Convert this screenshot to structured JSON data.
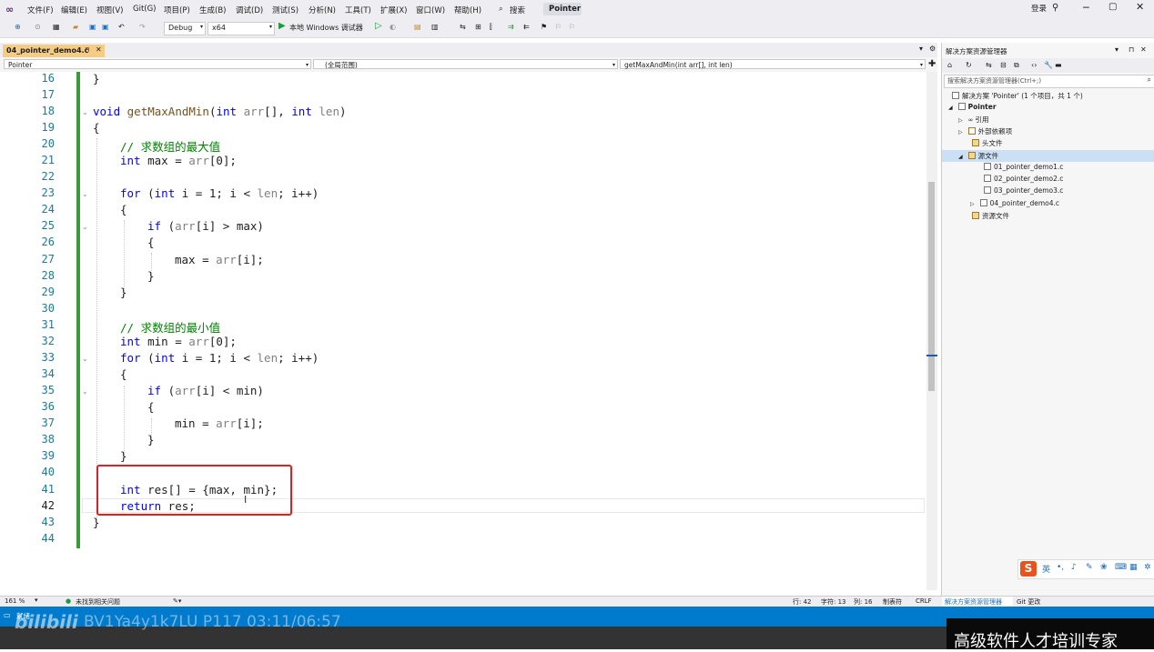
{
  "menubar": {
    "items": [
      "文件(F)",
      "编辑(E)",
      "视图(V)",
      "Git(G)",
      "项目(P)",
      "生成(B)",
      "调试(D)",
      "测试(S)",
      "分析(N)",
      "工具(T)",
      "扩展(X)",
      "窗口(W)",
      "帮助(H)"
    ],
    "search": "搜索",
    "solution_name": "Pointer",
    "login": "登录"
  },
  "toolbar": {
    "config": "Debug",
    "platform": "x64",
    "run_label": "本地 Windows 调试器"
  },
  "tab": {
    "label": "04_pointer_demo4.c"
  },
  "navbar": {
    "project": "Pointer",
    "scope": "(全局范围)",
    "member": "getMaxAndMin(int arr[], int len)"
  },
  "editor": {
    "line_numbers": [
      "16",
      "17",
      "18",
      "19",
      "20",
      "21",
      "22",
      "23",
      "24",
      "25",
      "26",
      "27",
      "28",
      "29",
      "30",
      "31",
      "32",
      "33",
      "34",
      "35",
      "36",
      "37",
      "38",
      "39",
      "40",
      "41",
      "42",
      "43",
      "44"
    ],
    "current_line": "42"
  },
  "solution_explorer": {
    "title": "解决方案资源管理器",
    "search_placeholder": "搜索解决方案资源管理器(Ctrl+;)",
    "solution": "解决方案 'Pointer' (1 个项目，共 1 个)",
    "project": "Pointer",
    "nodes": [
      "引用",
      "外部依赖项",
      "头文件",
      "源文件"
    ],
    "files": [
      "01_pointer_demo1.c",
      "02_pointer_demo2.c",
      "03_pointer_demo3.c",
      "04_pointer_demo4.c"
    ],
    "resources": "资源文件",
    "tabs": [
      "解决方案资源管理器",
      "Git 更改"
    ]
  },
  "status": {
    "zoom": "161 %",
    "issues": "未找到相关问题",
    "line": "行: 42",
    "char": "字符: 13",
    "col": "列: 16",
    "tabs": "制表符",
    "eol": "CRLF",
    "ready": "就绪"
  },
  "overlay": {
    "bv": "BV1Ya4y1k7LU P117 03:11/06:57",
    "brand": "高级软件人才培训专家"
  }
}
